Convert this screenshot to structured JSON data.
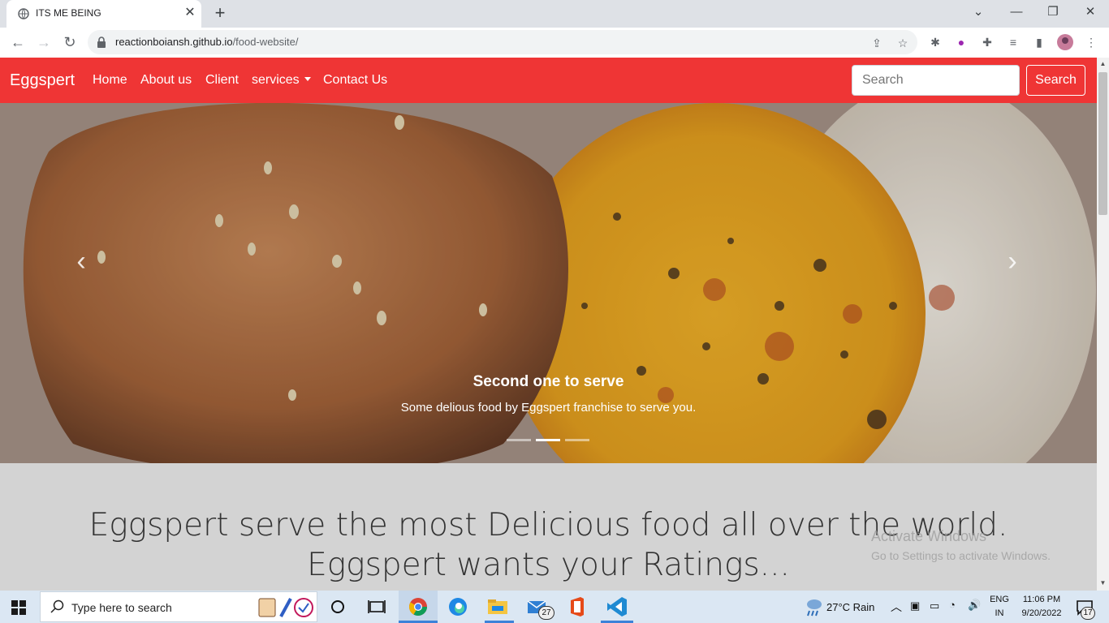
{
  "browser": {
    "tab_title": "ITS ME BEING",
    "url_host": "reactionboiansh.github.io",
    "url_path": "/food-website/"
  },
  "site": {
    "brand": "Eggspert",
    "nav": [
      "Home",
      "About us",
      "Client",
      "services",
      "Contact Us"
    ],
    "search_placeholder": "Search",
    "search_button": "Search"
  },
  "carousel": {
    "caption_title": "Second one to serve",
    "caption_text": "Some delious food by Eggspert franchise to serve you.",
    "slide_count": 3,
    "active_slide": 2
  },
  "section": {
    "headline_1": "Eggspert serve the most Delicious food all over the world.",
    "headline_2": "Eggspert wants your Ratings..."
  },
  "watermark": {
    "title": "Activate Windows",
    "text": "Go to Settings to activate Windows."
  },
  "taskbar": {
    "search_placeholder": "Type here to search",
    "weather": "27°C  Rain",
    "lang_1": "ENG",
    "lang_2": "IN",
    "time": "11:06 PM",
    "date": "9/20/2022",
    "mail_badge": "27",
    "notif_badge": "17"
  },
  "colors": {
    "navbar": "#ef3535",
    "section_bg": "#d3d3d3"
  }
}
